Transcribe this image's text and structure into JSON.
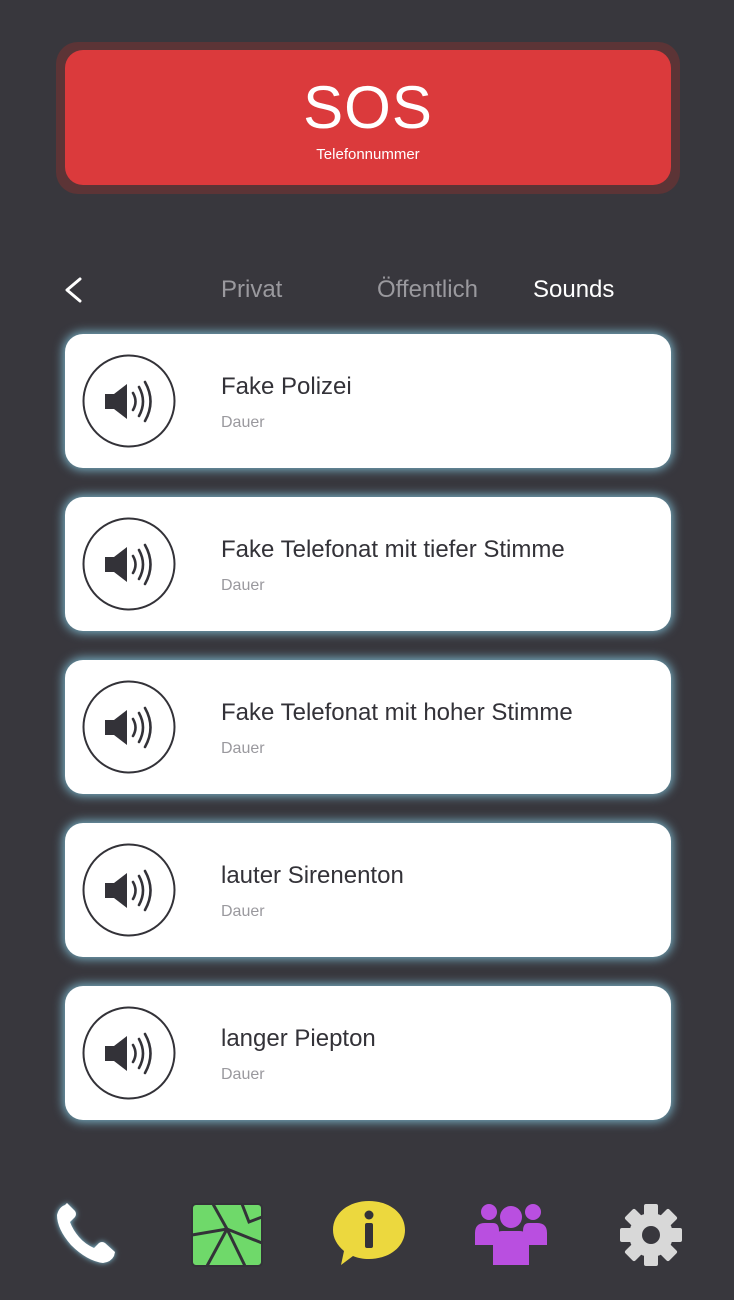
{
  "sos": {
    "title": "SOS",
    "subtitle": "Telefonnummer"
  },
  "tabs": [
    {
      "label": "Privat",
      "active": false
    },
    {
      "label": "Öffentlich",
      "active": false
    },
    {
      "label": "Sounds",
      "active": true
    }
  ],
  "sounds": [
    {
      "title": "Fake Polizei",
      "subtitle": "Dauer",
      "icon": "speaker-icon"
    },
    {
      "title": "Fake Telefonat mit tiefer Stimme",
      "subtitle": "Dauer",
      "icon": "speaker-icon"
    },
    {
      "title": "Fake Telefonat mit hoher Stimme",
      "subtitle": "Dauer",
      "icon": "speaker-icon"
    },
    {
      "title": "lauter Sirenenton",
      "subtitle": "Dauer",
      "icon": "speaker-icon"
    },
    {
      "title": "langer Piepton",
      "subtitle": "Dauer",
      "icon": "speaker-icon"
    }
  ],
  "bottom_nav": [
    {
      "icon": "phone-icon",
      "color": "#ffffff",
      "active": true
    },
    {
      "icon": "map-icon",
      "color": "#6fd96a",
      "active": false
    },
    {
      "icon": "info-icon",
      "color": "#ecd83e",
      "active": false
    },
    {
      "icon": "group-icon",
      "color": "#b94fe0",
      "active": false
    },
    {
      "icon": "gear-icon",
      "color": "#d8d8d8",
      "active": false
    }
  ],
  "colors": {
    "background": "#38373d",
    "sos_red": "#db3a3c",
    "card_glow": "#8cd7f0",
    "inactive_text": "#9a999e"
  }
}
